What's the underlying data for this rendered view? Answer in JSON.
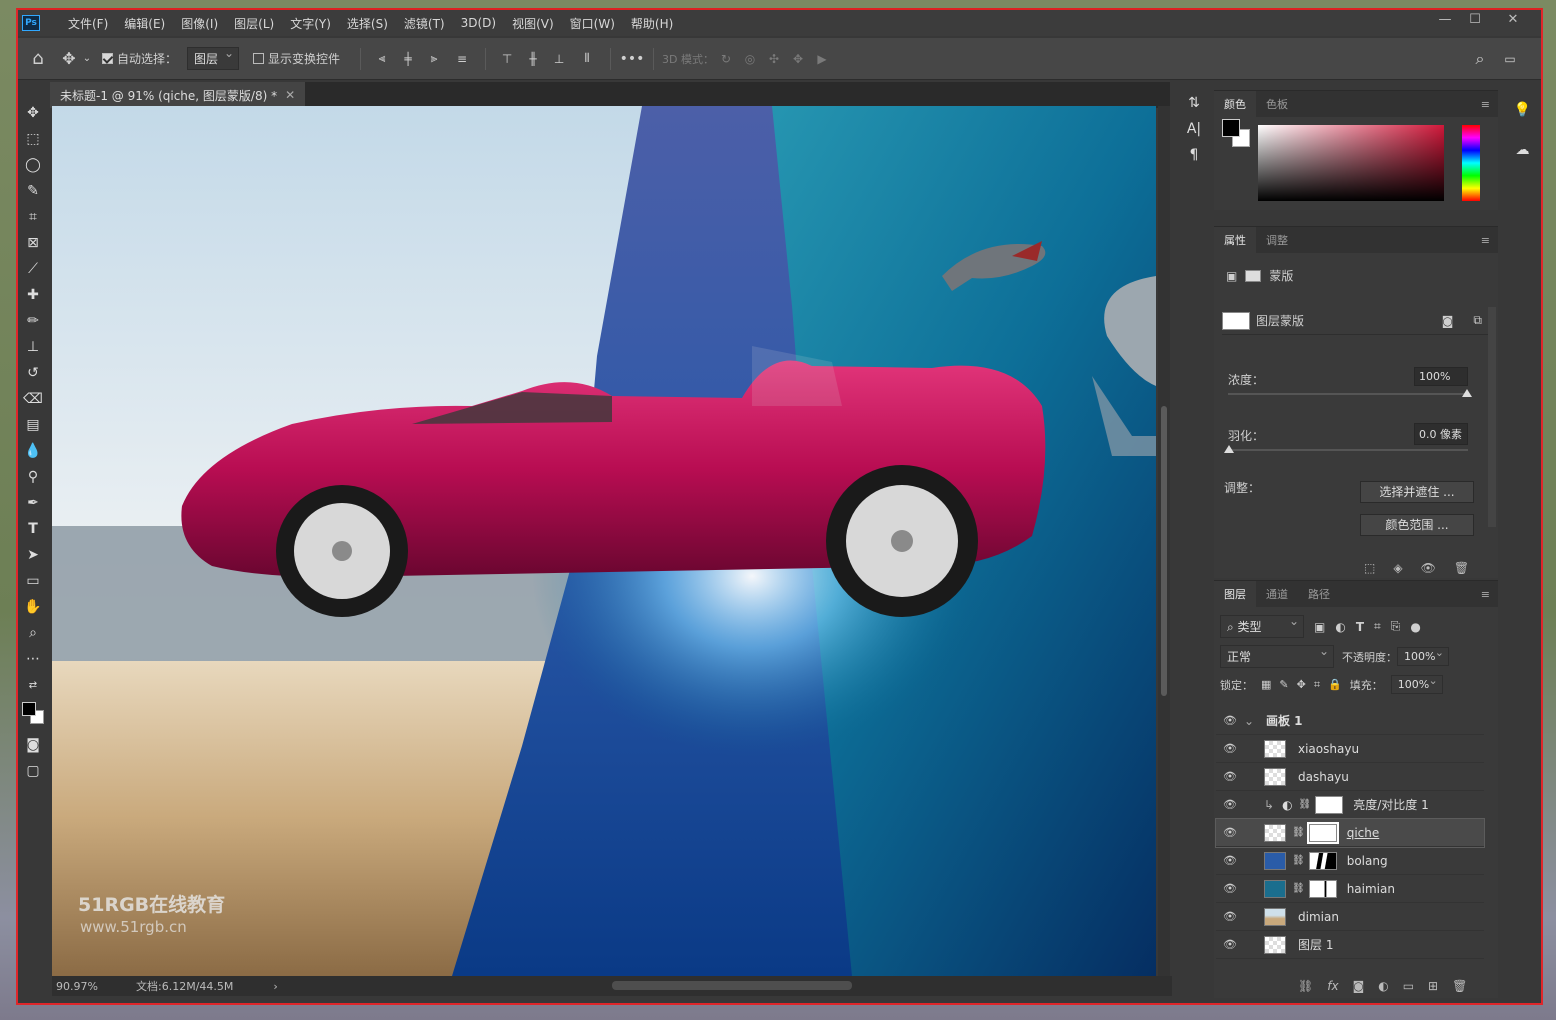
{
  "app": {
    "logo": "Ps",
    "logo_color": "#31a8ff"
  },
  "menu": [
    "文件(F)",
    "编辑(E)",
    "图像(I)",
    "图层(L)",
    "文字(Y)",
    "选择(S)",
    "滤镜(T)",
    "3D(D)",
    "视图(V)",
    "窗口(W)",
    "帮助(H)"
  ],
  "options": {
    "auto_select_label": "自动选择：",
    "auto_select_checked": true,
    "auto_select_target": "图层",
    "show_transform_label": "显示变换控件",
    "show_transform_checked": false,
    "mode_3d_label": "3D 模式："
  },
  "document": {
    "tab_title": "未标题-1 @ 91% (qiche, 图层蒙版/8) *",
    "zoom": "90.97%",
    "doc_info": "文档:6.12M/44.5M",
    "watermark_line1": "51RGB在线教育",
    "watermark_line2": "www.51rgb.cn"
  },
  "color_panel": {
    "tabs": [
      "颜色",
      "色板"
    ],
    "foreground": "#000000",
    "background": "#ffffff",
    "hue_color": "#d0183a"
  },
  "properties_panel": {
    "tabs": [
      "属性",
      "调整"
    ],
    "type_label": "蒙版",
    "mask_label": "图层蒙版",
    "density_label": "浓度：",
    "density_value": "100%",
    "feather_label": "羽化：",
    "feather_value": "0.0 像素",
    "adjust_label": "调整：",
    "select_mask_button": "选择并遮住 ...",
    "color_range_button": "颜色范围 ..."
  },
  "layers_panel": {
    "tabs": [
      "图层",
      "通道",
      "路径"
    ],
    "filter_kind": "类型",
    "blend_mode": "正常",
    "opacity_label": "不透明度：",
    "opacity_value": "100%",
    "lock_label": "锁定：",
    "fill_label": "填充：",
    "fill_value": "100%",
    "group_name": "画板 1",
    "layers": [
      {
        "name": "xiaoshayu",
        "selected": false,
        "mask": false
      },
      {
        "name": "dashayu",
        "selected": false,
        "mask": false
      },
      {
        "name": "亮度/对比度 1",
        "selected": false,
        "mask": true
      },
      {
        "name": "qiche",
        "selected": true,
        "mask": true
      },
      {
        "name": "bolang",
        "selected": false,
        "mask": true
      },
      {
        "name": "haimian",
        "selected": false,
        "mask": true
      },
      {
        "name": "dimian",
        "selected": false,
        "mask": false
      },
      {
        "name": "图层 1",
        "selected": false,
        "mask": false
      }
    ]
  },
  "car_color": "#c8105a",
  "ocean_color": "#0e5a8a"
}
